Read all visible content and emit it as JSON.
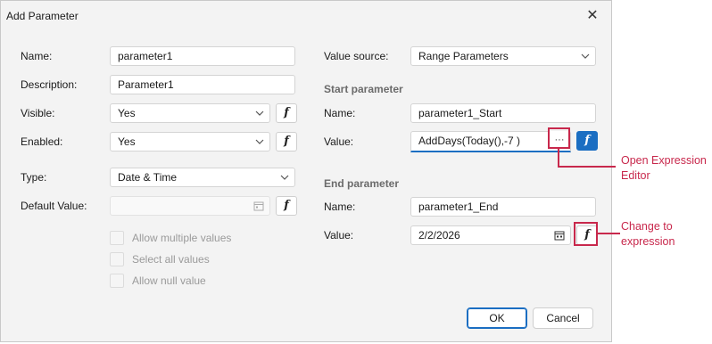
{
  "dialog": {
    "title": "Add Parameter"
  },
  "left": {
    "name_label": "Name:",
    "name_value": "parameter1",
    "description_label": "Description:",
    "description_value": "Parameter1",
    "visible_label": "Visible:",
    "visible_value": "Yes",
    "enabled_label": "Enabled:",
    "enabled_value": "Yes",
    "type_label": "Type:",
    "type_value": "Date & Time",
    "default_label": "Default Value:",
    "default_value": "",
    "checkboxes": [
      "Allow multiple values",
      "Select all values",
      "Allow null value"
    ]
  },
  "right": {
    "source_label": "Value source:",
    "source_value": "Range Parameters",
    "start_heading": "Start parameter",
    "start_name_label": "Name:",
    "start_name_value": "parameter1_Start",
    "start_value_label": "Value:",
    "start_value_value": "AddDays(Today(),-7 )",
    "ellipsis": "···",
    "end_heading": "End parameter",
    "end_name_label": "Name:",
    "end_name_value": "parameter1_End",
    "end_value_label": "Value:",
    "end_value_value": "2/2/2026"
  },
  "function_glyph": "f",
  "buttons": {
    "ok": "OK",
    "cancel": "Cancel"
  },
  "callouts": {
    "open_editor": "Open Expression Editor",
    "change_expression": "Change to expression"
  },
  "colors": {
    "accent": "#1b6ec2",
    "annotation": "#c8284c"
  }
}
